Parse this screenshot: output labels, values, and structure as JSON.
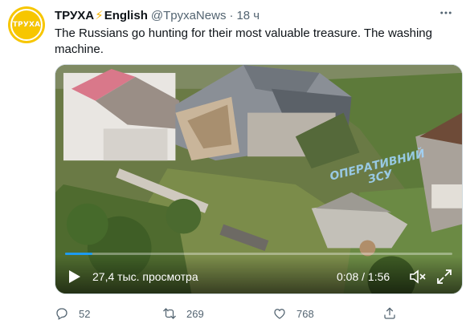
{
  "author": {
    "display_name": "ТРУХА",
    "bolt": "⚡",
    "name_suffix": "English",
    "handle": "@TpyxaNews",
    "separator": "·",
    "time": "18 ч",
    "avatar_text": "ТРУХА"
  },
  "tweet": {
    "text": "The Russians go hunting for their most valuable treasure. The washing machine."
  },
  "video": {
    "watermark_line1": "ОПЕРАТИВНИЙ",
    "watermark_line2": "ЗСУ",
    "views": "27,4 тыс. просмотра",
    "timecode": "0:08 / 1:56",
    "progress_fraction": 0.07
  },
  "actions": {
    "reply_count": "52",
    "retweet_count": "269",
    "like_count": "768"
  },
  "colors": {
    "accent": "#1d9bf0",
    "avatar_bg": "#f7c600",
    "muted_text": "#536471"
  },
  "icons": [
    "more-icon",
    "play-icon",
    "volume-icon",
    "fullscreen-icon",
    "reply-icon",
    "retweet-icon",
    "like-icon",
    "share-icon"
  ]
}
